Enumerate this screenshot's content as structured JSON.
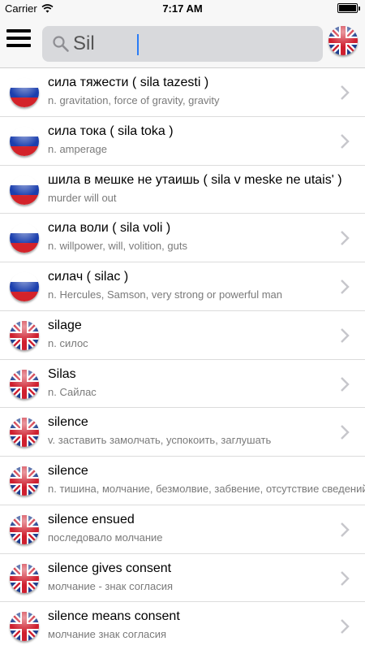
{
  "status_bar": {
    "carrier": "Carrier",
    "time": "7:17 AM"
  },
  "search": {
    "value": "Sil"
  },
  "results": [
    {
      "title": "сила тяжести ( sila tazesti )",
      "subtitle": "n. gravitation, force of gravity, gravity",
      "flag": "russian-flag-icon"
    },
    {
      "title": "сила тока ( sila toka )",
      "subtitle": "n. amperage",
      "flag": "russian-flag-icon"
    },
    {
      "title": "шила в мешке не утаишь ( sila v meske ne utais' )",
      "subtitle": "murder will out",
      "flag": "russian-flag-icon"
    },
    {
      "title": "сила воли ( sila voli )",
      "subtitle": "n. willpower, will, volition, guts",
      "flag": "russian-flag-icon"
    },
    {
      "title": "силач ( silac )",
      "subtitle": "n. Hercules, Samson, very strong or powerful man",
      "flag": "russian-flag-icon"
    },
    {
      "title": "silage",
      "subtitle": "n. силос",
      "flag": "uk-flag-icon"
    },
    {
      "title": "Silas",
      "subtitle": "n. Сайлас",
      "flag": "uk-flag-icon"
    },
    {
      "title": "silence",
      "subtitle": "v. заставить замолчать, успокоить, заглушать",
      "flag": "uk-flag-icon"
    },
    {
      "title": "silence",
      "subtitle": "n. тишина, молчание, безмолвие, забвение, отсутствие сведений",
      "flag": "uk-flag-icon"
    },
    {
      "title": "silence ensued",
      "subtitle": "последовало молчание",
      "flag": "uk-flag-icon"
    },
    {
      "title": "silence gives consent",
      "subtitle": "молчание - знак согласия",
      "flag": "uk-flag-icon"
    },
    {
      "title": "silence means consent",
      "subtitle": "молчание знак согласия",
      "flag": "uk-flag-icon"
    }
  ],
  "colors": {
    "nav_bg": "#f7f7f7",
    "search_bg": "#d8d9dc",
    "chevron": "#c7c7cc",
    "subtitle": "#7a7a7a",
    "caret": "#2a7cf6"
  }
}
